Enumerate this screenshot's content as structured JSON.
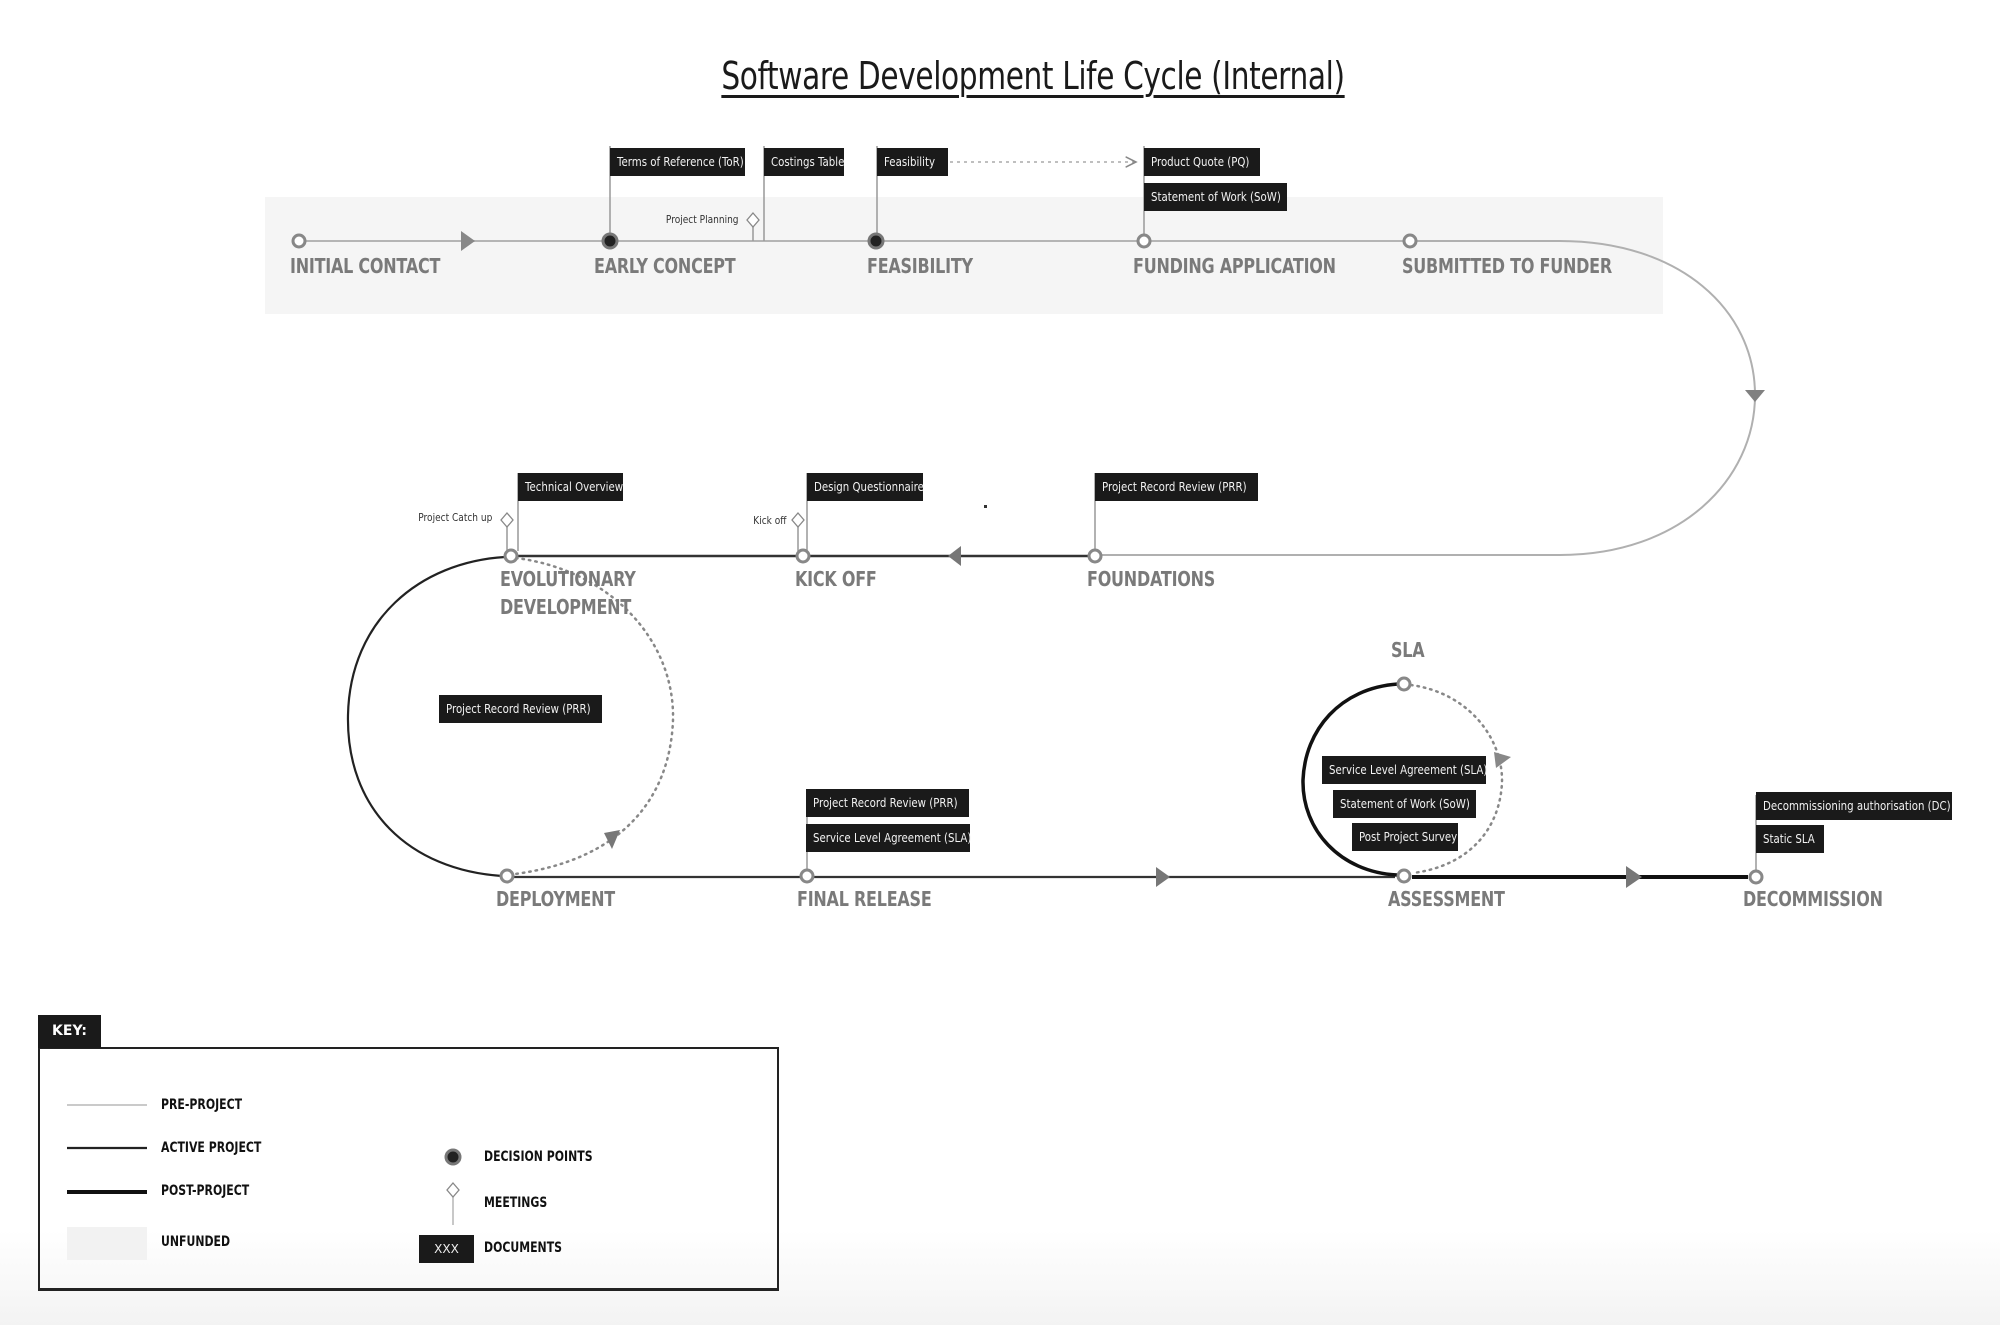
{
  "title": "Software Development Life Cycle (Internal)",
  "colors": {
    "pre_project_line": "#b0b0b0",
    "active_project_line": "#333333",
    "post_project_line": "#111111",
    "unfunded_fill": "#f5f5f5",
    "document_fill": "#1a1a1a",
    "stage_label": "#7a7a7a",
    "node_stroke": "#888888"
  },
  "stages": [
    {
      "id": "initial-contact",
      "label": "INITIAL CONTACT",
      "node": "milestone",
      "phase": "pre-project"
    },
    {
      "id": "early-concept",
      "label": "EARLY CONCEPT",
      "node": "decision",
      "phase": "pre-project"
    },
    {
      "id": "feasibility",
      "label": "FEASIBILITY",
      "node": "decision",
      "phase": "pre-project"
    },
    {
      "id": "funding-application",
      "label": "FUNDING APPLICATION",
      "node": "milestone",
      "phase": "pre-project"
    },
    {
      "id": "submitted-to-funder",
      "label": "SUBMITTED TO FUNDER",
      "node": "milestone",
      "phase": "pre-project"
    },
    {
      "id": "foundations",
      "label": "FOUNDATIONS",
      "node": "milestone",
      "phase": "active-project"
    },
    {
      "id": "kick-off",
      "label": "KICK OFF",
      "node": "milestone",
      "phase": "active-project"
    },
    {
      "id": "evolutionary-development",
      "label_lines": [
        "EVOLUTIONARY",
        "DEVELOPMENT"
      ],
      "node": "milestone",
      "phase": "active-project"
    },
    {
      "id": "deployment",
      "label": "DEPLOYMENT",
      "node": "milestone",
      "phase": "active-project"
    },
    {
      "id": "final-release",
      "label": "FINAL RELEASE",
      "node": "milestone",
      "phase": "active-project"
    },
    {
      "id": "assessment",
      "label": "ASSESSMENT",
      "node": "milestone",
      "phase": "post-project"
    },
    {
      "id": "sla",
      "label": "SLA",
      "node": "milestone",
      "phase": "post-project"
    },
    {
      "id": "decommission",
      "label": "DECOMMISSION",
      "node": "milestone",
      "phase": "post-project"
    }
  ],
  "documents": {
    "early_concept": [
      "Terms of Reference (ToR)"
    ],
    "costings": [
      "Costings Table"
    ],
    "feasibility": [
      "Feasibility"
    ],
    "funding_application": [
      "Product Quote (PQ)",
      "Statement of Work (SoW)"
    ],
    "foundations": [
      "Project Record Review (PRR)"
    ],
    "kick_off": [
      "Design Questionnaire"
    ],
    "evolutionary_development": [
      "Technical Overview"
    ],
    "dev_loop": [
      "Project Record Review (PRR)"
    ],
    "final_release": [
      "Project Record Review (PRR)",
      "Service Level Agreement (SLA)"
    ],
    "sla_loop": [
      "Service Level Agreement (SLA)",
      "Statement of Work (SoW)",
      "Post Project Survey"
    ],
    "decommission": [
      "Decommissioning authorisation (DC)",
      "Static SLA"
    ]
  },
  "meetings": {
    "project_planning": "Project Planning",
    "kick_off": "Kick off",
    "project_catch_up": "Project Catch up"
  },
  "connections": [
    {
      "from": "Feasibility",
      "to": "Product Quote (PQ)",
      "style": "dotted-arrow"
    }
  ],
  "key": {
    "tab_label": "KEY:",
    "lines": [
      {
        "label": "PRE-PROJECT",
        "style": "thin-grey"
      },
      {
        "label": "ACTIVE PROJECT",
        "style": "medium-dark"
      },
      {
        "label": "POST-PROJECT",
        "style": "thick-black"
      },
      {
        "label": "UNFUNDED",
        "style": "light-grey-fill"
      }
    ],
    "symbols": [
      {
        "label": "DECISION POINTS",
        "icon": "filled-circle"
      },
      {
        "label": "MEETINGS",
        "icon": "diamond-on-stem"
      },
      {
        "label": "DOCUMENTS",
        "icon": "black-box",
        "sample_text": "XXX"
      }
    ]
  }
}
